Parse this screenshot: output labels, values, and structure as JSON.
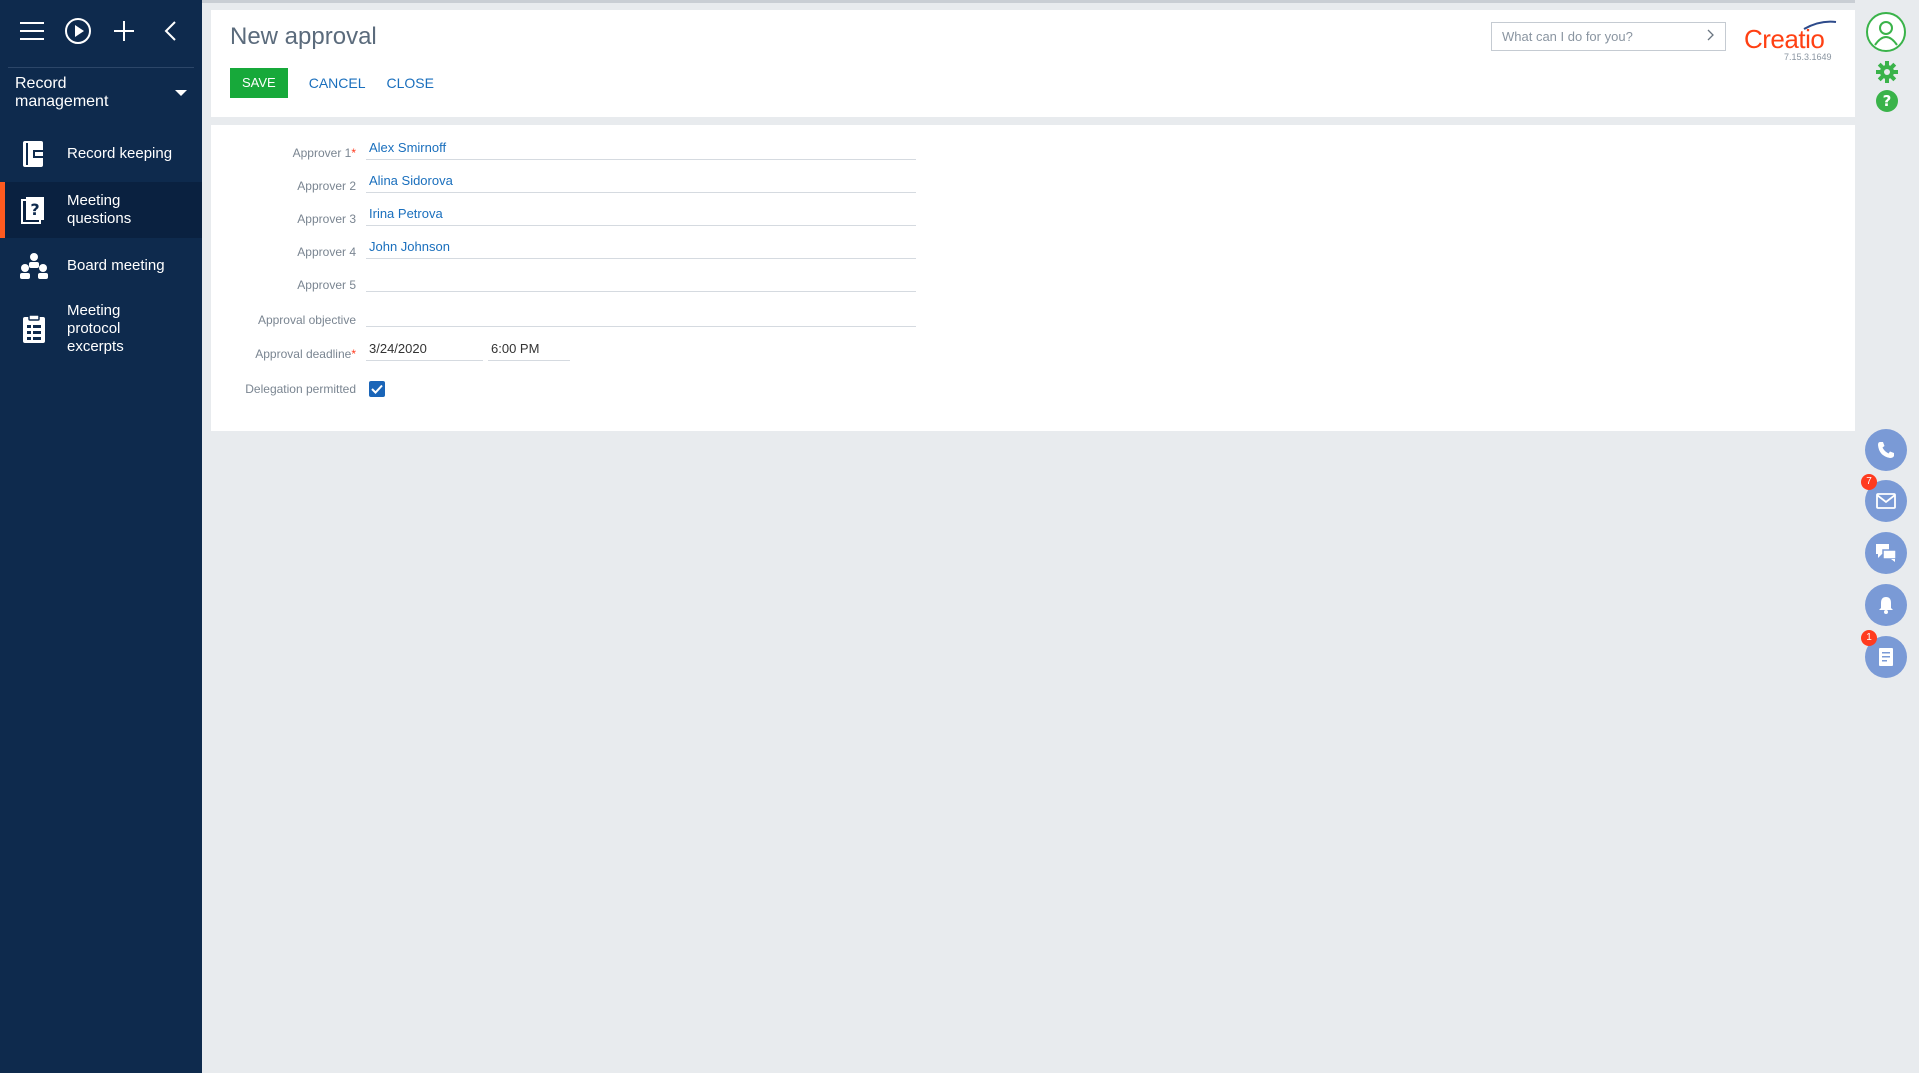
{
  "sidebar": {
    "workspace": "Record management",
    "items": [
      {
        "label": "Record keeping",
        "icon": "record-keeping-icon",
        "active": false
      },
      {
        "label": "Meeting\nquestions",
        "icon": "meeting-questions-icon",
        "active": true
      },
      {
        "label": "Board meeting",
        "icon": "board-meeting-icon",
        "active": false
      },
      {
        "label": "Meeting\nprotocol\nexcerpts",
        "icon": "protocol-excerpts-icon",
        "active": false
      }
    ]
  },
  "header": {
    "title": "New approval",
    "save_label": "SAVE",
    "cancel_label": "CANCEL",
    "close_label": "CLOSE",
    "search_placeholder": "What can I do for you?",
    "logo_text": "Creatio",
    "version": "7.15.3.1649"
  },
  "form": {
    "fields": [
      {
        "label": "Approver 1",
        "required": true,
        "value": "Alex Smirnoff"
      },
      {
        "label": "Approver 2",
        "required": false,
        "value": "Alina Sidorova"
      },
      {
        "label": "Approver 3",
        "required": false,
        "value": "Irina Petrova"
      },
      {
        "label": "Approver 4",
        "required": false,
        "value": "John Johnson"
      },
      {
        "label": "Approver 5",
        "required": false,
        "value": ""
      },
      {
        "label": "Approval objective",
        "required": false,
        "value": ""
      }
    ],
    "deadline": {
      "label": "Approval deadline",
      "required": true,
      "date": "3/24/2020",
      "time": "6:00 PM"
    },
    "delegation": {
      "label": "Delegation permitted",
      "checked": true
    }
  },
  "rightbar": {
    "email_badge": "7",
    "tasks_badge": "1"
  },
  "colors": {
    "sidebar_bg": "#0e2a4d",
    "active_accent": "#ff5a1f",
    "save_button": "#17a93a",
    "link": "#1a6fbd",
    "logo": "#ff4013",
    "comm_button": "#7a9ad6",
    "badge": "#ff3b1f"
  }
}
